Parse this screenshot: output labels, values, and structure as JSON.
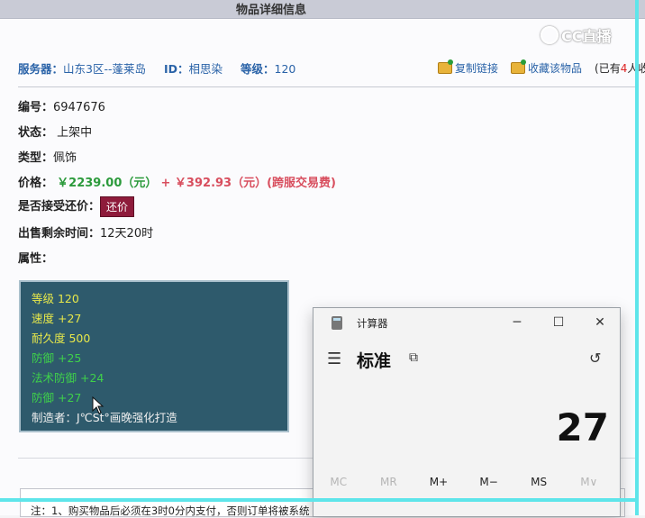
{
  "page_title": "物品详细信息",
  "watermark": "CC直播",
  "server": {
    "label": "服务器：",
    "value": "山东3区--蓬莱岛",
    "id_label": "ID：",
    "id_value": "相思染",
    "level_label": "等级：",
    "level_value": "120"
  },
  "actions": {
    "copy_link": "复制链接",
    "favorite": "收藏该物品",
    "owned_prefix": "(已有",
    "owned_count": "4",
    "owned_suffix": "人收"
  },
  "fields": {
    "number_label": "编号：",
    "number_value": "6947676",
    "status_label": "状态：",
    "status_value": "上架中",
    "type_label": "类型：",
    "type_value": "佩饰",
    "price_label": "价格：",
    "price_value": "￥2239.00（元）",
    "price_plus": "+ ￥392.93（元）(跨服交易费)",
    "bargain_label": "是否接受还价：",
    "bargain_button": "还价",
    "time_label": "出售剩余时间：",
    "time_value": "12天20时",
    "attr_label": "属性："
  },
  "attributes": [
    {
      "text": "等级 120",
      "color": "yellow"
    },
    {
      "text": "速度 +27",
      "color": "yellow"
    },
    {
      "text": "耐久度 500",
      "color": "yellow"
    },
    {
      "text": "防御 +25",
      "color": "green"
    },
    {
      "text": "法术防御 +24",
      "color": "green"
    },
    {
      "text": "防御 +27",
      "color": "green"
    },
    {
      "text": "制造者：J℃St°画晚强化打造",
      "color": "white"
    }
  ],
  "notice": "注：1、购买物品后必须在3时0分内支付，否则订单将被系统",
  "calculator": {
    "app_title": "计算器",
    "mode": "标准",
    "display": "27",
    "minimize": "─",
    "maximize": "☐",
    "close": "✕",
    "menu_icon": "☰",
    "keep_on_top_icon": "⧉",
    "history_icon": "↺",
    "memory": [
      "MC",
      "MR",
      "M+",
      "M−",
      "MS",
      "M∨"
    ]
  },
  "colors": {
    "frame": "#5ee5ea",
    "attr_bg": "#2e5a6c",
    "price_green": "#2b9a3b",
    "price_red": "#d84e5e",
    "bargain_bg": "#8e1b3b"
  }
}
